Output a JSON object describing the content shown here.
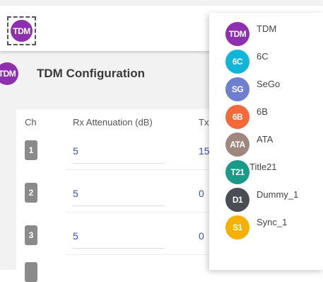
{
  "header": {
    "selected_device": {
      "abbr": "TDM",
      "color": "#8e2fb0"
    }
  },
  "config": {
    "abbr": "TDM",
    "avatar_color": "#8e2fb0",
    "title": "TDM Configuration"
  },
  "table": {
    "columns": [
      "Ch",
      "Rx Attenuation (dB)",
      "Tx"
    ],
    "rows": [
      {
        "ch": "1",
        "rx": "5",
        "tx": "15"
      },
      {
        "ch": "2",
        "rx": "5",
        "tx": "0"
      },
      {
        "ch": "3",
        "rx": "5",
        "tx": "0"
      }
    ]
  },
  "dropdown": {
    "items": [
      {
        "abbr": "TDM",
        "label": "TDM",
        "color": "#8e2fb0"
      },
      {
        "abbr": "6C",
        "label": "6C",
        "color": "#12b5d8"
      },
      {
        "abbr": "SG",
        "label": "SeGo",
        "color": "#6f7fcf"
      },
      {
        "abbr": "6B",
        "label": "6B",
        "color": "#f4683a"
      },
      {
        "abbr": "ATA",
        "label": "ATA",
        "color": "#a0877d"
      },
      {
        "abbr": "T21",
        "label": "Title21",
        "color": "#1a9a88"
      },
      {
        "abbr": "D1",
        "label": "Dummy_1",
        "color": "#4a4d54"
      },
      {
        "abbr": "S1",
        "label": "Sync_1",
        "color": "#f5b000"
      }
    ]
  }
}
